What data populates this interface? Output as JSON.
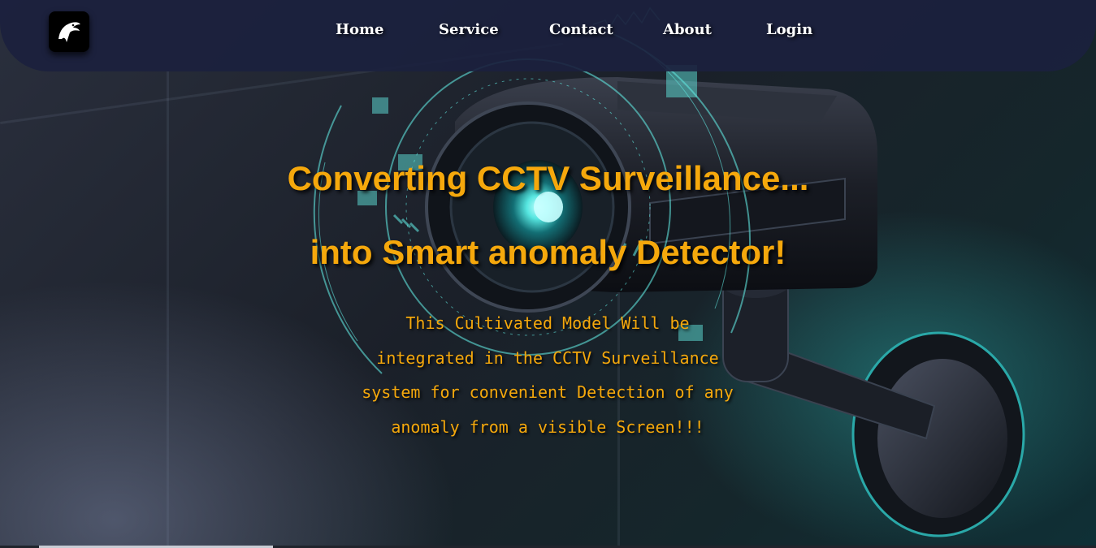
{
  "nav": {
    "logo_icon": "eagle-logo-icon",
    "links": [
      {
        "label": "Home"
      },
      {
        "label": "Service"
      },
      {
        "label": "Contact"
      },
      {
        "label": "About"
      },
      {
        "label": "Login"
      }
    ]
  },
  "hero": {
    "title_line1": "Converting CCTV Surveillance...",
    "title_line2": "into Smart anomaly Detector!",
    "description_lines": [
      "This Cultivated Model Will be",
      "integrated in the CCTV Surveillance",
      "system for convenient Detection of any",
      "anomaly from a visible Screen!!!"
    ],
    "background_image": "cctv-camera-image"
  },
  "colors": {
    "accent": "#f5a80c",
    "navbar": "#1b213e",
    "hud": "#5fe3dc"
  }
}
